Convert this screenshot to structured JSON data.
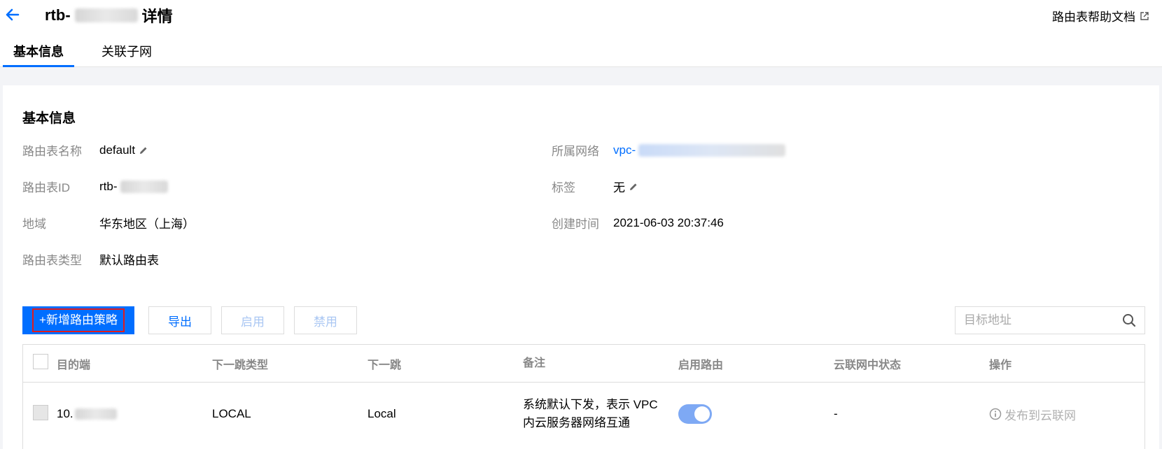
{
  "header": {
    "title_prefix": "rtb-",
    "title_suffix": "详情",
    "help_link": "路由表帮助文档"
  },
  "tabs": [
    {
      "label": "基本信息",
      "active": true
    },
    {
      "label": "关联子网",
      "active": false
    }
  ],
  "basic": {
    "section_title": "基本信息",
    "left": [
      {
        "label": "路由表名称",
        "value": "default",
        "editable": true
      },
      {
        "label": "路由表ID",
        "value": "rtb-",
        "editable": false
      },
      {
        "label": "地域",
        "value": "华东地区（上海）",
        "editable": false
      },
      {
        "label": "路由表类型",
        "value": "默认路由表",
        "editable": false
      }
    ],
    "right": [
      {
        "label": "所属网络",
        "value": "vpc-",
        "link": true
      },
      {
        "label": "标签",
        "value": "无",
        "editable": true
      },
      {
        "label": "创建时间",
        "value": "2021-06-03 20:37:46"
      }
    ]
  },
  "toolbar": {
    "add_label": "+新增路由策略",
    "export_label": "导出",
    "enable_label": "启用",
    "disable_label": "禁用",
    "search_placeholder": "目标地址"
  },
  "table": {
    "columns": [
      "目的端",
      "下一跳类型",
      "下一跳",
      "备注",
      "启用路由",
      "云联网中状态",
      "操作"
    ],
    "rows": [
      {
        "destination": "10.",
        "next_hop_type": "LOCAL",
        "next_hop": "Local",
        "remark_line1": "系统默认下发，表示 VPC",
        "remark_line2": "内云服务器网络互通",
        "enabled": true,
        "ccn_status": "-",
        "action": "发布到云联网"
      }
    ]
  },
  "colors": {
    "primary": "#006eff",
    "highlight_border": "#e21c1c"
  }
}
